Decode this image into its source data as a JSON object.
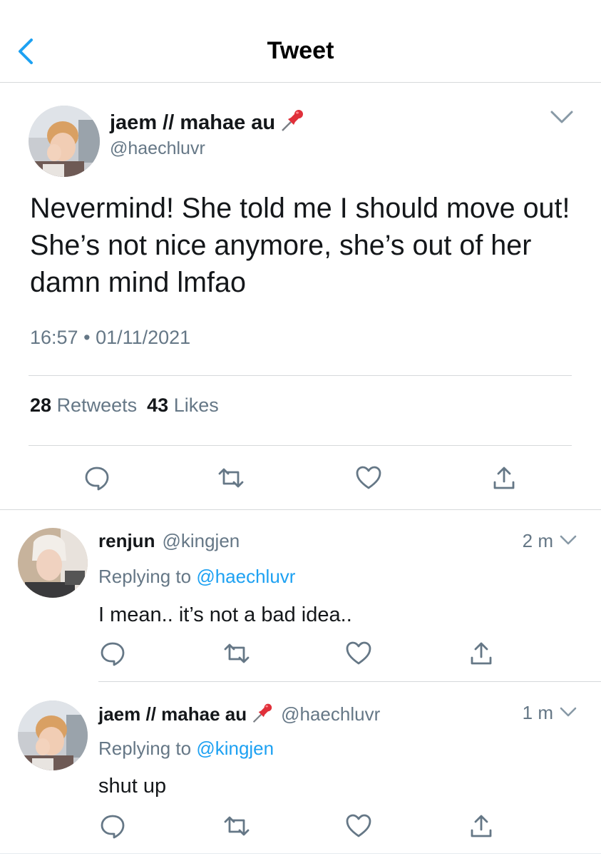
{
  "header": {
    "title": "Tweet",
    "back_icon": "chevron-left-icon"
  },
  "tweet": {
    "display_name": "jaem // mahae au",
    "emoji": "📌",
    "handle": "@haechluvr",
    "text": "Nevermind! She told me I should move out! She’s not nice anymore, she’s out of her damn mind lmfao",
    "time": "16:57",
    "separator": "•",
    "date": "01/11/2021",
    "retweets_count": "28",
    "retweets_label": "Retweets",
    "likes_count": "43",
    "likes_label": "Likes"
  },
  "replies": [
    {
      "display_name": "renjun",
      "handle": "@kingjen",
      "time": "2 m",
      "replying_prefix": "Replying to",
      "replying_to": "@haechluvr",
      "text": "I mean.. it’s not a bad idea.."
    },
    {
      "display_name": "jaem // mahae au",
      "emoji": "📌",
      "handle": "@haechluvr",
      "time": "1 m",
      "replying_prefix": "Replying to",
      "replying_to": "@kingjen",
      "text": "shut up"
    }
  ],
  "actions": [
    "reply-icon",
    "retweet-icon",
    "like-icon",
    "share-icon"
  ],
  "colors": {
    "link": "#1da1f2",
    "secondary_text": "#657786",
    "divider": "#d6d9db",
    "primary_text": "#14171a"
  }
}
